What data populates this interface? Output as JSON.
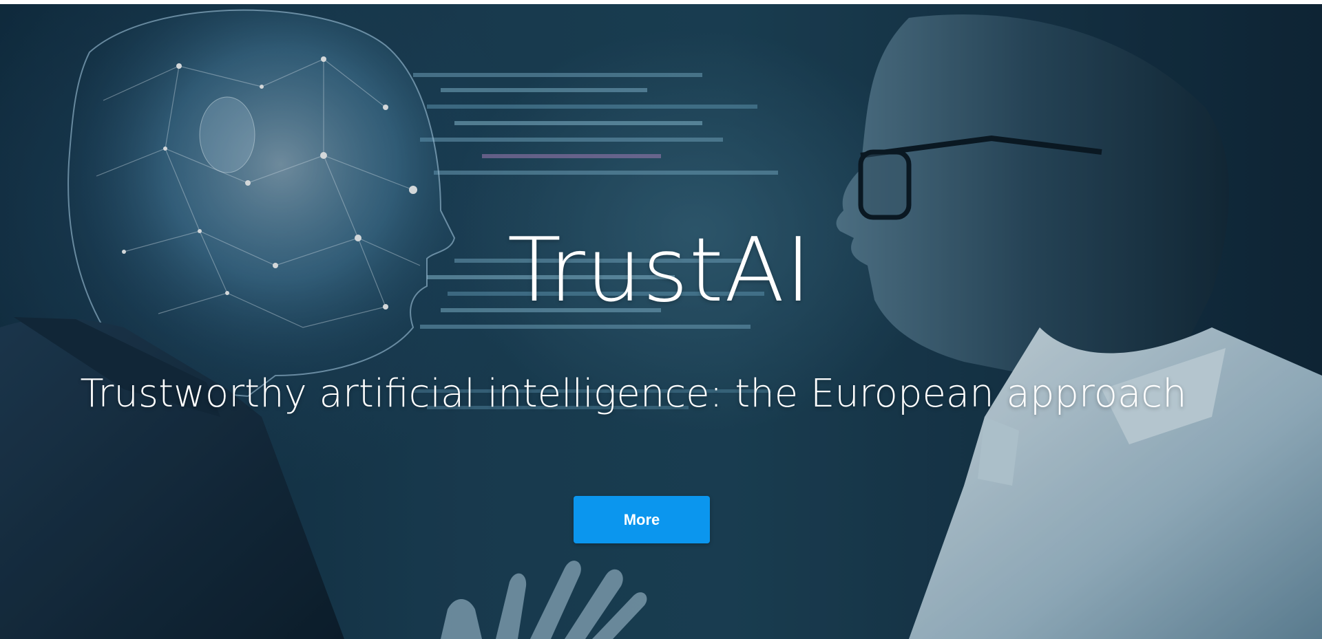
{
  "hero": {
    "title": "TrustAI",
    "subtitle": "Trustworthy artificial intelligence: the European approach",
    "button_label": "More",
    "button_color": "#0b96ee",
    "background_colors": [
      "#0f2a3d",
      "#1d4358",
      "#0f2536"
    ],
    "image_subject": "digital-ai-head-facing-human-with-glasses"
  }
}
